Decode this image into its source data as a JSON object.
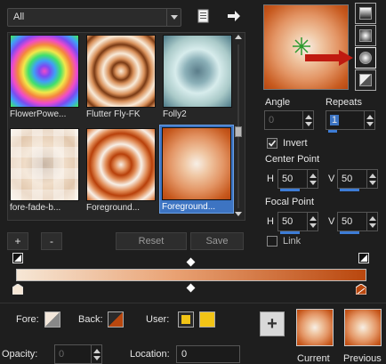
{
  "filter": {
    "value": "All"
  },
  "gallery": {
    "items": [
      {
        "name": "FlowerPowe...",
        "selected": false
      },
      {
        "name": "Flutter Fly-FK",
        "selected": false
      },
      {
        "name": "Folly2",
        "selected": false
      },
      {
        "name": "fore-fade-b...",
        "selected": false
      },
      {
        "name": "Foreground...",
        "selected": false
      },
      {
        "name": "Foreground...",
        "selected": true
      }
    ]
  },
  "buttons": {
    "add": "+",
    "remove": "-",
    "reset": "Reset",
    "save": "Save"
  },
  "editor": {
    "angle_label": "Angle",
    "angle_value": "0",
    "repeats_label": "Repeats",
    "repeats_value": "1",
    "invert_label": "Invert",
    "invert_checked": true,
    "center_point_label": "Center Point",
    "center_h_label": "H",
    "center_h_value": "50",
    "center_v_label": "V",
    "center_v_value": "50",
    "focal_point_label": "Focal Point",
    "focal_h_label": "H",
    "focal_h_value": "50",
    "focal_v_label": "V",
    "focal_v_value": "50",
    "link_label": "Link",
    "link_checked": false
  },
  "colors": {
    "gradient_start": "#f6e7d6",
    "gradient_end": "#b9470e",
    "accent": "#3d74c2",
    "highlight_arrow": "#c01a10",
    "user_swatch": "#f2c416"
  },
  "bottom": {
    "fore_label": "Fore:",
    "back_label": "Back:",
    "user_label": "User:",
    "opacity_label": "Opacity:",
    "opacity_value": "0",
    "location_label": "Location:",
    "location_value": "0",
    "current_label": "Current",
    "previous_label": "Previous",
    "add_label": "+"
  }
}
